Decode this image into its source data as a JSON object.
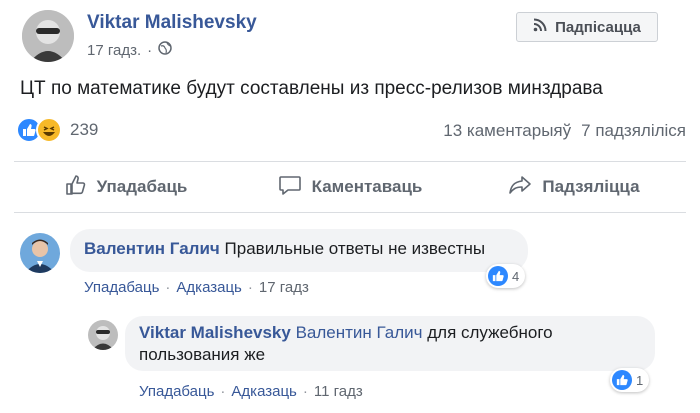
{
  "post": {
    "author": "Viktar Malishevsky",
    "time": "17 гадз.",
    "separator": "·",
    "subscribe_label": "Падпісацца",
    "text": "ЦТ по математике будут составлены из пресс-релизов минздрава",
    "reactions_count": "239",
    "comments_count": "13 каментарыяў",
    "shares_count": "7 падзяліліся",
    "icons": [
      "like-reaction-icon",
      "haha-reaction-icon",
      "globe-icon",
      "rss-icon"
    ]
  },
  "actions": {
    "like": "Упадабаць",
    "comment": "Каментаваць",
    "share": "Падзяліцца"
  },
  "comments": [
    {
      "author": "Валентин Галич",
      "text": "Правильные ответы не известны",
      "likes": "4",
      "like_label": "Упадабаць",
      "reply_label": "Адказаць",
      "time": "17 гадз",
      "separator": "·"
    },
    {
      "author": "Viktar Malishevsky",
      "mention": "Валентин Галич",
      "text": "для служебного пользования же",
      "likes": "1",
      "like_label": "Упадабаць",
      "reply_label": "Адказаць",
      "time": "11 гадз",
      "separator": "·"
    }
  ],
  "colors": {
    "link": "#385898",
    "like_blue": "#2d88ff",
    "muted": "#606770",
    "bubble": "#f2f3f5"
  }
}
